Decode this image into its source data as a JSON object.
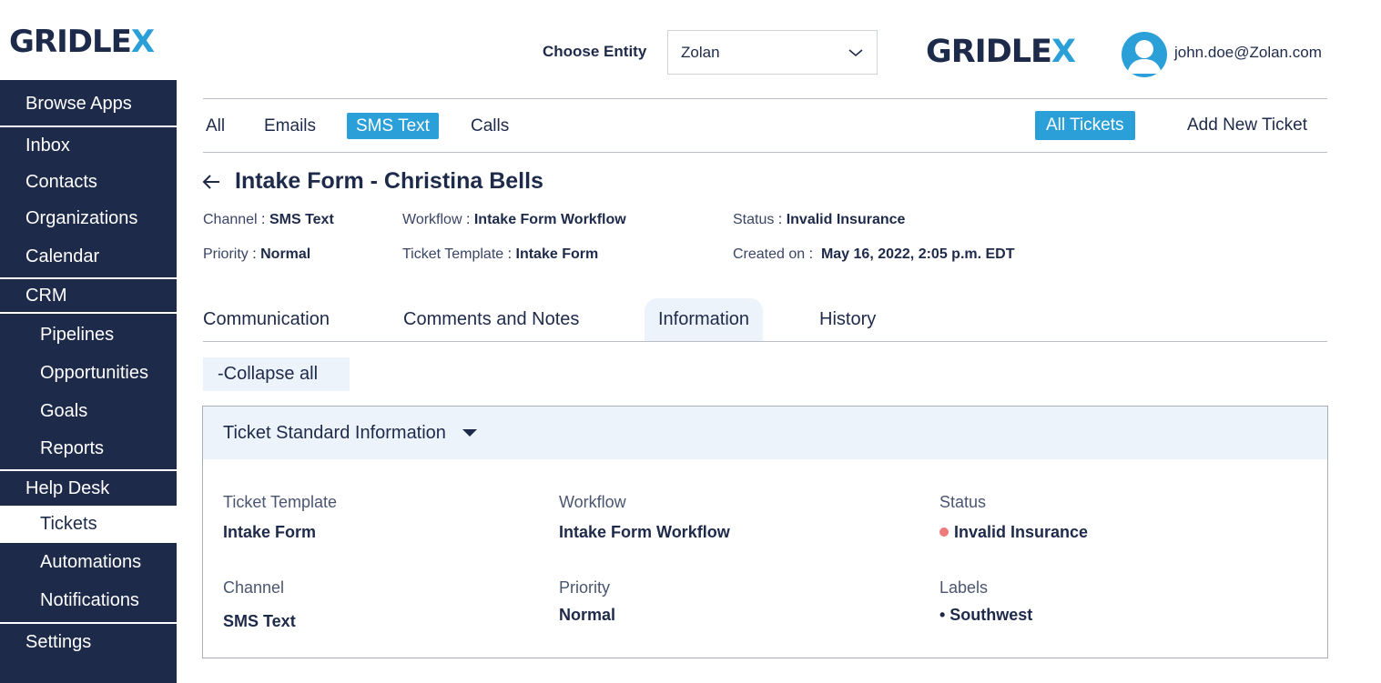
{
  "brand": {
    "logo_main": "GRIDLE",
    "logo_accent": "X"
  },
  "header": {
    "entity_label": "Choose Entity",
    "entity_value": "Zolan",
    "user_email": "john.doe@Zolan.com"
  },
  "sidebar": {
    "items": [
      {
        "label": "Browse Apps"
      },
      {
        "label": "Inbox"
      },
      {
        "label": "Contacts"
      },
      {
        "label": "Organizations"
      },
      {
        "label": "Calendar"
      },
      {
        "label": "CRM"
      },
      {
        "label": "Pipelines"
      },
      {
        "label": "Opportunities"
      },
      {
        "label": "Goals"
      },
      {
        "label": "Reports"
      },
      {
        "label": "Help Desk"
      },
      {
        "label": "Tickets"
      },
      {
        "label": "Automations"
      },
      {
        "label": "Notifications"
      },
      {
        "label": "Settings"
      }
    ],
    "active": "Tickets"
  },
  "channel_tabs": [
    {
      "label": "All"
    },
    {
      "label": "Emails"
    },
    {
      "label": "SMS Text"
    },
    {
      "label": "Calls"
    }
  ],
  "channel_active": "SMS Text",
  "ticket_actions": {
    "all_tickets": "All Tickets",
    "add_new": "Add New Ticket"
  },
  "ticket": {
    "title": "Intake Form - Christina Bells",
    "meta": {
      "channel_k": "Channel",
      "channel_v": "SMS Text",
      "workflow_k": "Workflow",
      "workflow_v": "Intake Form Workflow",
      "status_k": "Status",
      "status_v": "Invalid Insurance",
      "priority_k": "Priority",
      "priority_v": "Normal",
      "template_k": "Ticket Template",
      "template_v": "Intake Form",
      "created_k": "Created on",
      "created_v": "May 16, 2022, 2:05 p.m. EDT"
    }
  },
  "detail_tabs": [
    {
      "label": "Communication"
    },
    {
      "label": "Comments and Notes"
    },
    {
      "label": "Information"
    },
    {
      "label": "History"
    }
  ],
  "detail_active": "Information",
  "collapse_label": "-Collapse all",
  "panel": {
    "title": "Ticket Standard Information",
    "fields": {
      "template_label": "Ticket Template",
      "template_value": "Intake Form",
      "workflow_label": "Workflow",
      "workflow_value": "Intake Form Workflow",
      "status_label": "Status",
      "status_value": "Invalid Insurance",
      "channel_label": "Channel",
      "channel_value": "SMS Text",
      "priority_label": "Priority",
      "priority_value": "Normal",
      "labels_label": "Labels",
      "labels_value": "• Southwest"
    }
  },
  "colors": {
    "navy": "#1e2a4a",
    "accent": "#2a9fd8",
    "status_dot": "#f07a7a",
    "tab_bg": "#edf3fb"
  }
}
